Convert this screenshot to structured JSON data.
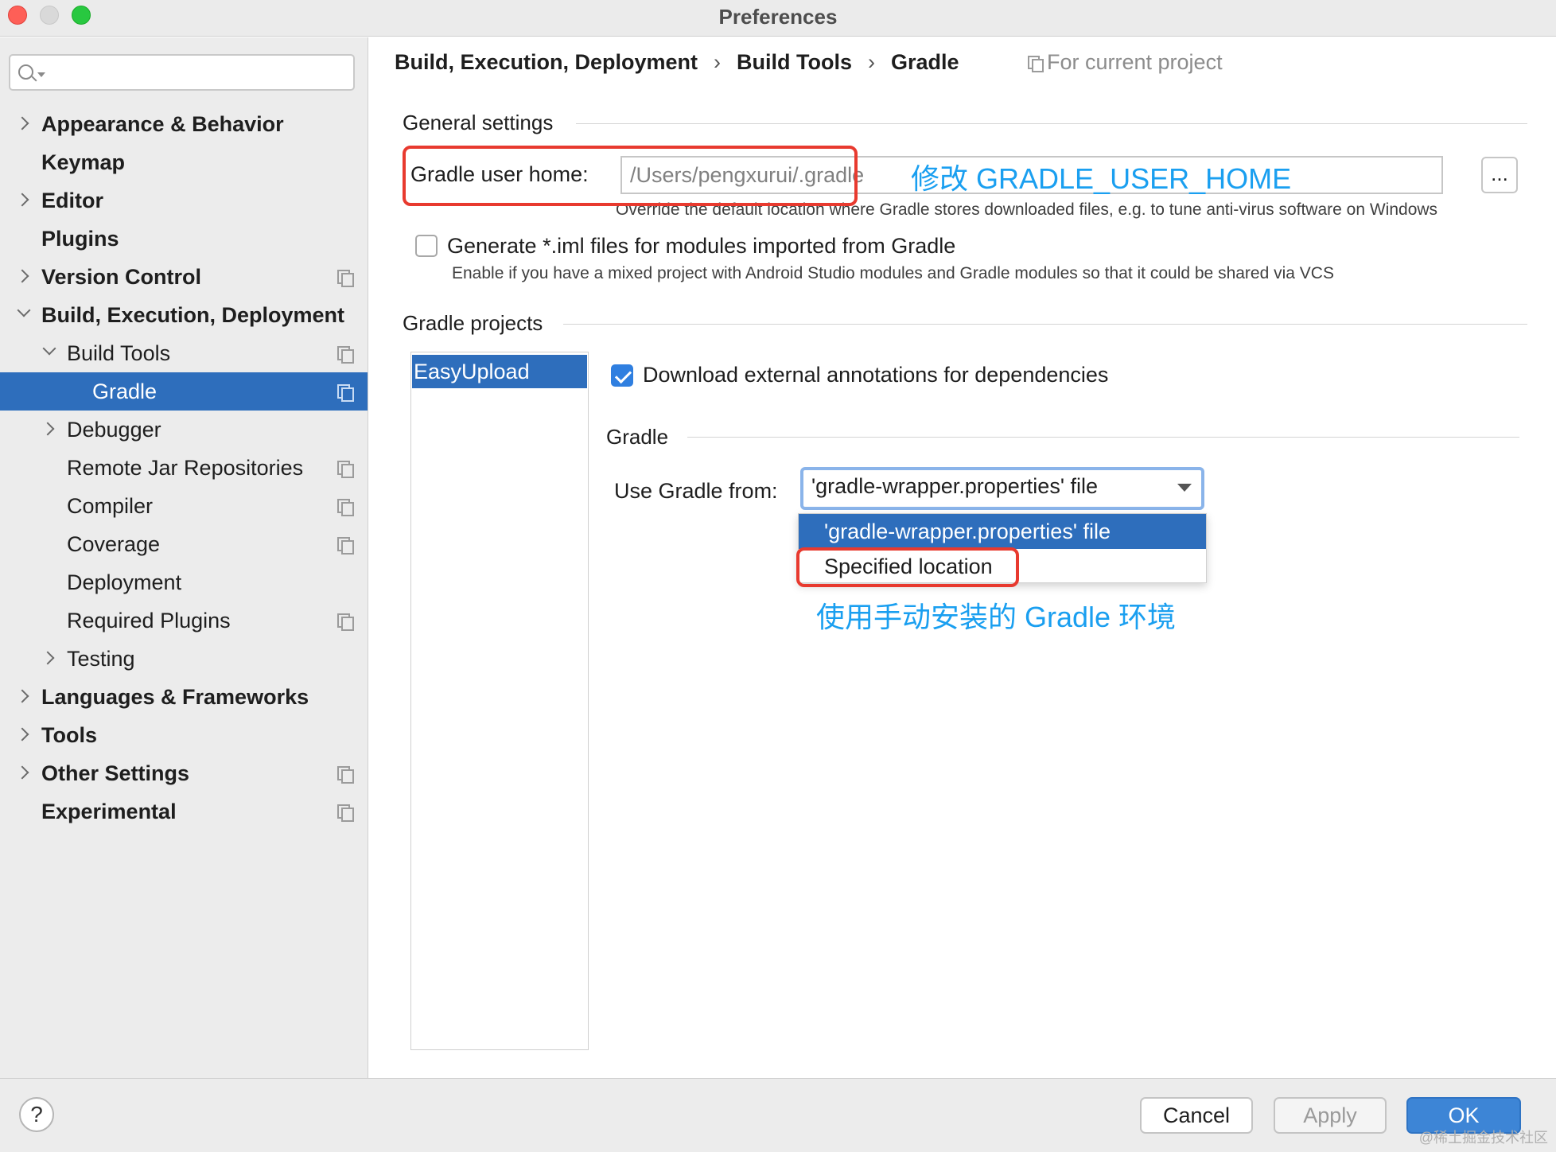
{
  "window": {
    "title": "Preferences"
  },
  "search": {
    "placeholder": ""
  },
  "sidebar": {
    "items": [
      {
        "label": "Appearance & Behavior"
      },
      {
        "label": "Keymap"
      },
      {
        "label": "Editor"
      },
      {
        "label": "Plugins"
      },
      {
        "label": "Version Control"
      },
      {
        "label": "Build, Execution, Deployment"
      },
      {
        "label": "Build Tools"
      },
      {
        "label": "Gradle"
      },
      {
        "label": "Debugger"
      },
      {
        "label": "Remote Jar Repositories"
      },
      {
        "label": "Compiler"
      },
      {
        "label": "Coverage"
      },
      {
        "label": "Deployment"
      },
      {
        "label": "Required Plugins"
      },
      {
        "label": "Testing"
      },
      {
        "label": "Languages & Frameworks"
      },
      {
        "label": "Tools"
      },
      {
        "label": "Other Settings"
      },
      {
        "label": "Experimental"
      }
    ]
  },
  "breadcrumb": {
    "items": [
      "Build, Execution, Deployment",
      "Build Tools",
      "Gradle"
    ],
    "separator": "›",
    "scope": "For current project"
  },
  "general": {
    "title": "General settings",
    "gradle_home_label": "Gradle user home:",
    "gradle_home_value": "/Users/pengxurui/.gradle",
    "browse_label": "...",
    "gradle_home_hint": "Override the default location where Gradle stores downloaded files, e.g. to tune anti-virus software on Windows",
    "iml_label": "Generate *.iml files for modules imported from Gradle",
    "iml_checked": false,
    "iml_hint": "Enable if you have a mixed project with Android Studio modules and Gradle modules so that it could be shared via VCS"
  },
  "projects": {
    "title": "Gradle projects",
    "items": [
      "EasyUpload"
    ],
    "download_annotations_label": "Download external annotations for dependencies",
    "download_annotations_checked": true,
    "gradle_section_title": "Gradle",
    "use_gradle_from_label": "Use Gradle from:",
    "use_gradle_from_value": "'gradle-wrapper.properties' file",
    "options": [
      "'gradle-wrapper.properties' file",
      "Specified location"
    ]
  },
  "annotations": {
    "home_note": "修改 GRADLE_USER_HOME",
    "location_note": "使用手动安装的 Gradle 环境"
  },
  "footer": {
    "help_label": "?",
    "cancel_label": "Cancel",
    "apply_label": "Apply",
    "ok_label": "OK"
  },
  "watermark": "@稀土掘金技术社区",
  "colors": {
    "selection": "#2e6ebc",
    "annotation_red": "#e83a2f",
    "annotation_blue": "#1a9ff0"
  }
}
